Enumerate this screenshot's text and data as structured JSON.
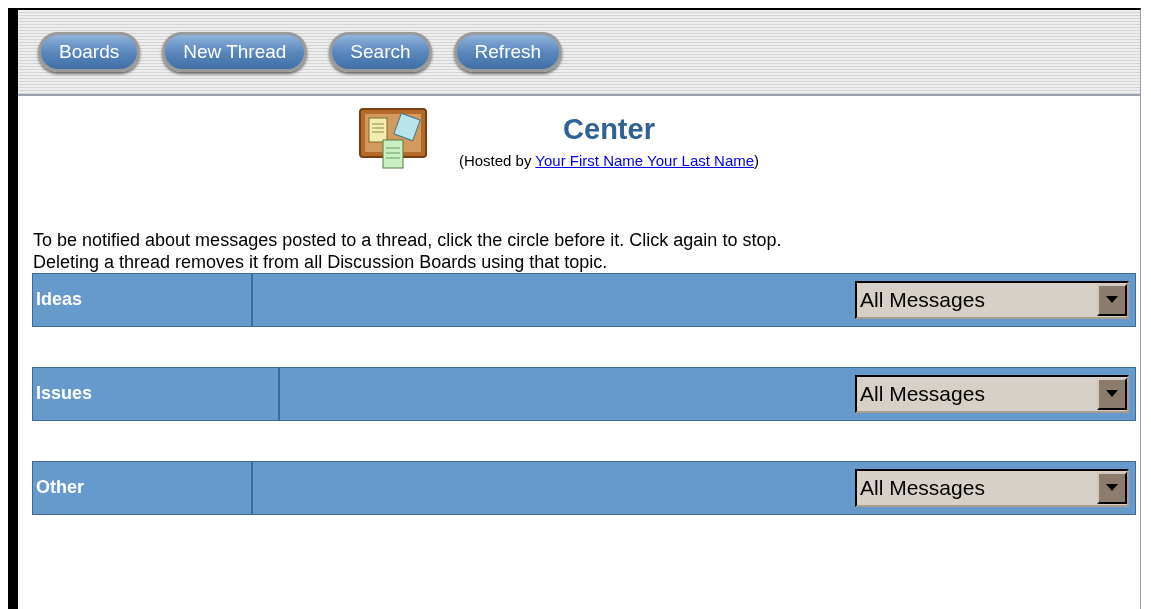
{
  "toolbar": {
    "buttons": [
      "Boards",
      "New Thread",
      "Search",
      "Refresh"
    ]
  },
  "header": {
    "title": "Center",
    "hosted_prefix": "(Hosted by ",
    "host_link": "Your First Name Your Last Name",
    "hosted_suffix": ")"
  },
  "instructions": [
    "To be notified about messages posted to a thread, click the circle before it. Click again to stop.",
    "Deleting a thread removes it from all Discussion Boards using that topic."
  ],
  "boards": [
    {
      "name": "Ideas",
      "filter": "All Messages"
    },
    {
      "name": "Issues",
      "filter": "All Messages"
    },
    {
      "name": "Other",
      "filter": "All Messages"
    }
  ]
}
